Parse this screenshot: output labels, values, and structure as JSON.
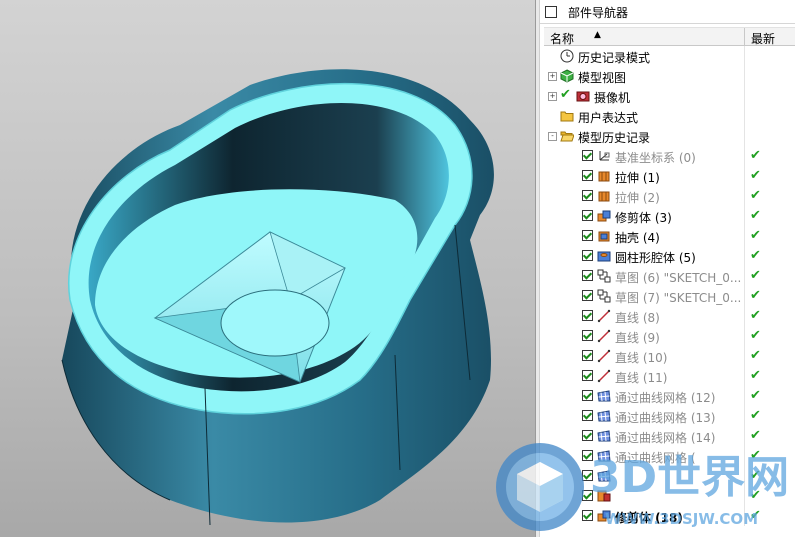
{
  "panel": {
    "title": "部件导航器",
    "col_name": "名称",
    "col_latest": "最新"
  },
  "tree": [
    {
      "label": "历史记录模式",
      "icon": "clock-icon",
      "indent": 1,
      "style": "normal",
      "checkbox": false,
      "status": "",
      "expander": ""
    },
    {
      "label": "模型视图",
      "icon": "model-views-icon",
      "indent": 1,
      "style": "normal",
      "checkbox": false,
      "status": "",
      "expander": "+"
    },
    {
      "label": "摄像机",
      "icon": "camera-icon",
      "indent": 1,
      "style": "normal",
      "checkbox": false,
      "status": "",
      "expander": "+",
      "tick": true
    },
    {
      "label": "用户表达式",
      "icon": "folder-icon",
      "indent": 1,
      "style": "normal",
      "checkbox": false,
      "status": "",
      "expander": ""
    },
    {
      "label": "模型历史记录",
      "icon": "folder-open-icon",
      "indent": 1,
      "style": "normal",
      "checkbox": false,
      "status": "",
      "expander": "-"
    },
    {
      "label": "基准坐标系 (0)",
      "icon": "datum-csys-icon",
      "indent": 2,
      "style": "dim",
      "checkbox": true,
      "status": "✔",
      "expander": ""
    },
    {
      "label": "拉伸 (1)",
      "icon": "extrude-icon",
      "indent": 2,
      "style": "normal",
      "checkbox": true,
      "status": "✔",
      "expander": ""
    },
    {
      "label": "拉伸 (2)",
      "icon": "extrude-icon",
      "indent": 2,
      "style": "dim",
      "checkbox": true,
      "status": "✔",
      "expander": ""
    },
    {
      "label": "修剪体 (3)",
      "icon": "trim-body-icon",
      "indent": 2,
      "style": "normal",
      "checkbox": true,
      "status": "✔",
      "expander": ""
    },
    {
      "label": "抽壳 (4)",
      "icon": "shell-icon",
      "indent": 2,
      "style": "normal",
      "checkbox": true,
      "status": "✔",
      "expander": ""
    },
    {
      "label": "圆柱形腔体 (5)",
      "icon": "pocket-icon",
      "indent": 2,
      "style": "normal",
      "checkbox": true,
      "status": "✔",
      "expander": ""
    },
    {
      "label": "草图 (6) \"SKETCH_0...",
      "icon": "sketch-icon",
      "indent": 2,
      "style": "dim",
      "checkbox": true,
      "status": "✔",
      "expander": ""
    },
    {
      "label": "草图 (7) \"SKETCH_0...",
      "icon": "sketch-icon",
      "indent": 2,
      "style": "dim",
      "checkbox": true,
      "status": "✔",
      "expander": ""
    },
    {
      "label": "直线 (8)",
      "icon": "line-icon",
      "indent": 2,
      "style": "dim",
      "checkbox": true,
      "status": "✔",
      "expander": ""
    },
    {
      "label": "直线 (9)",
      "icon": "line-icon",
      "indent": 2,
      "style": "dim",
      "checkbox": true,
      "status": "✔",
      "expander": ""
    },
    {
      "label": "直线 (10)",
      "icon": "line-icon",
      "indent": 2,
      "style": "dim",
      "checkbox": true,
      "status": "✔",
      "expander": ""
    },
    {
      "label": "直线 (11)",
      "icon": "line-icon",
      "indent": 2,
      "style": "dim",
      "checkbox": true,
      "status": "✔",
      "expander": ""
    },
    {
      "label": "通过曲线网格 (12)",
      "icon": "mesh-surface-icon",
      "indent": 2,
      "style": "dim",
      "checkbox": true,
      "status": "✔",
      "expander": ""
    },
    {
      "label": "通过曲线网格 (13)",
      "icon": "mesh-surface-icon",
      "indent": 2,
      "style": "dim",
      "checkbox": true,
      "status": "✔",
      "expander": ""
    },
    {
      "label": "通过曲线网格 (14)",
      "icon": "mesh-surface-icon",
      "indent": 2,
      "style": "dim",
      "checkbox": true,
      "status": "✔",
      "expander": ""
    },
    {
      "label": "通过曲线网格 (",
      "icon": "mesh-surface-icon",
      "indent": 2,
      "style": "dim",
      "checkbox": true,
      "status": "✔",
      "expander": ""
    },
    {
      "label": "",
      "icon": "mesh-surface-icon",
      "indent": 2,
      "style": "dim",
      "checkbox": true,
      "status": "✔",
      "expander": ""
    },
    {
      "label": "",
      "icon": "patch-icon",
      "indent": 2,
      "style": "dim",
      "checkbox": true,
      "status": "✔",
      "expander": ""
    },
    {
      "label": "修剪体 (18)",
      "icon": "trim-body-icon",
      "indent": 2,
      "style": "bold",
      "checkbox": true,
      "status": "✔",
      "expander": ""
    }
  ],
  "watermark": {
    "brand": "3D世界网",
    "url": "WWW.3DSJW.COM"
  },
  "colors": {
    "model_cyan": "#8ff6f8",
    "model_dark": "#1d4f63",
    "check_green": "#22a022"
  }
}
